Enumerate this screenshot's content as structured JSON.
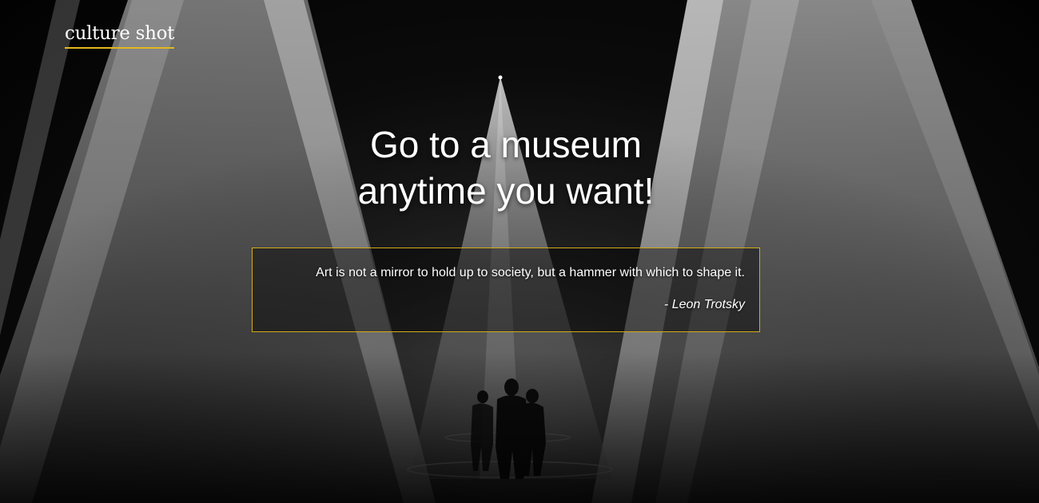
{
  "header": {
    "logo_text": "culture shot"
  },
  "hero": {
    "headline_line1": "Go to a museum",
    "headline_line2": "anytime you want!",
    "quote": {
      "text": "Art is not a mirror to hold up to society, but a hammer with which to shape it.",
      "author": "- Leon Trotsky"
    }
  },
  "colors": {
    "accent": "#e2b81d",
    "background": "#050505",
    "text": "#ffffff"
  }
}
